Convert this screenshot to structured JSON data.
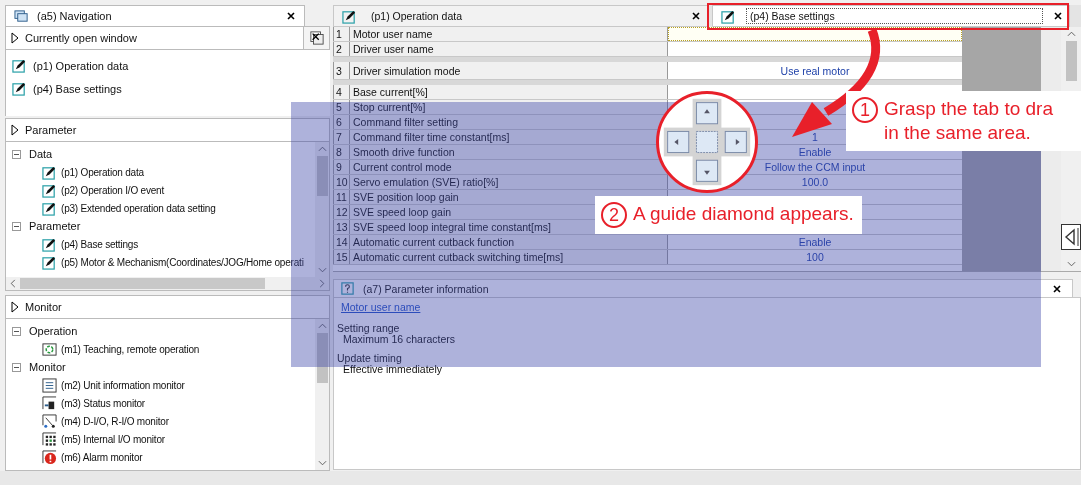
{
  "navigation": {
    "title": "(a5) Navigation",
    "open_windows": {
      "title": "Currently open window",
      "items": [
        {
          "label": "(p1) Operation data",
          "kind": "edit"
        },
        {
          "label": "(p4) Base settings",
          "kind": "edit"
        }
      ]
    },
    "trees": [
      {
        "title": "Parameter",
        "groups": [
          {
            "label": "Data",
            "expanded": true,
            "children": [
              {
                "label": "(p1) Operation data",
                "kind": "edit"
              },
              {
                "label": "(p2) Operation I/O event",
                "kind": "edit"
              },
              {
                "label": "(p3) Extended operation data setting",
                "kind": "edit"
              }
            ]
          },
          {
            "label": "Parameter",
            "expanded": true,
            "children": [
              {
                "label": "(p4) Base settings",
                "kind": "edit"
              },
              {
                "label": "(p5) Motor & Mechanism(Coordinates/JOG/Home operati",
                "kind": "edit"
              }
            ]
          }
        ]
      },
      {
        "title": "Monitor",
        "groups": [
          {
            "label": "Operation",
            "expanded": true,
            "children": [
              {
                "label": "(m1) Teaching, remote operation",
                "kind": "teaching"
              }
            ]
          },
          {
            "label": "Monitor",
            "expanded": true,
            "children": [
              {
                "label": "(m2) Unit information monitor",
                "kind": "info"
              },
              {
                "label": "(m3) Status monitor",
                "kind": "status"
              },
              {
                "label": "(m4) D-I/O, R-I/O monitor",
                "kind": "dio"
              },
              {
                "label": "(m5) Internal I/O monitor",
                "kind": "io"
              },
              {
                "label": "(m6) Alarm monitor",
                "kind": "alarm"
              }
            ]
          }
        ]
      }
    ]
  },
  "editor_tabs": [
    {
      "label": "(p1) Operation data",
      "selected": false
    },
    {
      "label": "(p4) Base settings",
      "selected": true
    }
  ],
  "table": {
    "groups": [
      {
        "rows": [
          {
            "no": "1",
            "name": "Motor user name",
            "selected": true
          },
          {
            "no": "2",
            "name": "Driver user name",
            "selected": false
          }
        ]
      },
      {
        "rows": [
          {
            "no": "3",
            "name": "Driver simulation mode",
            "value": "Use real motor",
            "selected": false
          }
        ]
      },
      {
        "rows": [
          {
            "no": "4",
            "name": "Base current[%]",
            "selected": false
          },
          {
            "no": "5",
            "name": "Stop current[%]",
            "selected": false
          },
          {
            "no": "6",
            "name": "Command filter setting",
            "selected": false
          },
          {
            "no": "7",
            "name": "Command filter time constant[ms]",
            "value": "1",
            "selected": false
          },
          {
            "no": "8",
            "name": "Smooth drive function",
            "value": "Enable",
            "selected": false
          },
          {
            "no": "9",
            "name": "Current control mode",
            "value": "Follow the CCM input",
            "selected": false
          },
          {
            "no": "10",
            "name": "Servo emulation (SVE) ratio[%]",
            "value": "100.0",
            "selected": false
          },
          {
            "no": "11",
            "name": "SVE position loop gain",
            "selected": false
          },
          {
            "no": "12",
            "name": "SVE speed loop gain",
            "selected": false
          },
          {
            "no": "13",
            "name": "SVE speed loop integral time constant[ms]",
            "selected": false
          },
          {
            "no": "14",
            "name": "Automatic current cutback function",
            "value": "Enable",
            "selected": false
          },
          {
            "no": "15",
            "name": "Automatic current cutback switching time[ms]",
            "value": "100",
            "selected": false
          }
        ]
      }
    ]
  },
  "info_panel": {
    "title": "(a7) Parameter information",
    "link": "Motor user name",
    "sections": [
      {
        "heading": "Setting range",
        "text": "Maximum 16 characters"
      },
      {
        "heading": "Update timing",
        "text": "Effective immediately"
      }
    ]
  },
  "annotations": [
    {
      "number": "1",
      "lines": [
        "Grasp the tab to dra",
        "in the same area."
      ]
    },
    {
      "number": "2",
      "lines": [
        "A guide diamond appears."
      ]
    }
  ]
}
